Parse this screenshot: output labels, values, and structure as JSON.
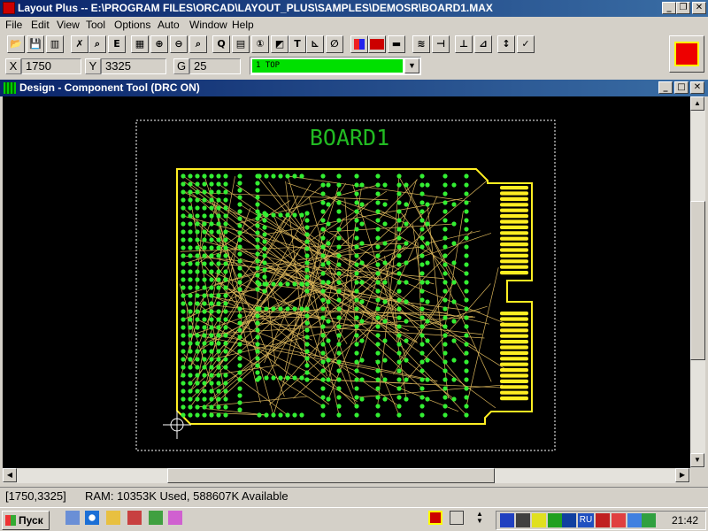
{
  "window": {
    "title": "Layout Plus -- E:\\PROGRAM FILES\\ORCAD\\LAYOUT_PLUS\\SAMPLES\\DEMOSR\\BOARD1.MAX"
  },
  "menu": [
    "File",
    "Edit",
    "View",
    "Tool",
    "Options",
    "Auto",
    "Window",
    "Help"
  ],
  "coords": {
    "x_label": "X",
    "x_value": "1750",
    "y_label": "Y",
    "y_value": "3325",
    "g_label": "G",
    "g_value": "25"
  },
  "layer": {
    "value": "1  TOP"
  },
  "subwindow": {
    "title": "Design - Component Tool (DRC ON)"
  },
  "board": {
    "label": "BOARD1"
  },
  "status": {
    "cursor": "[1750,3325]",
    "ram": "RAM: 10353K Used, 588607K Available"
  },
  "taskbar": {
    "start": "Пуск",
    "lang": "RU",
    "clock": "21:42"
  },
  "colors": {
    "pad": "#33ee33",
    "outline": "#ffee22",
    "rats": "#d9b45a",
    "label": "#22bb22"
  }
}
